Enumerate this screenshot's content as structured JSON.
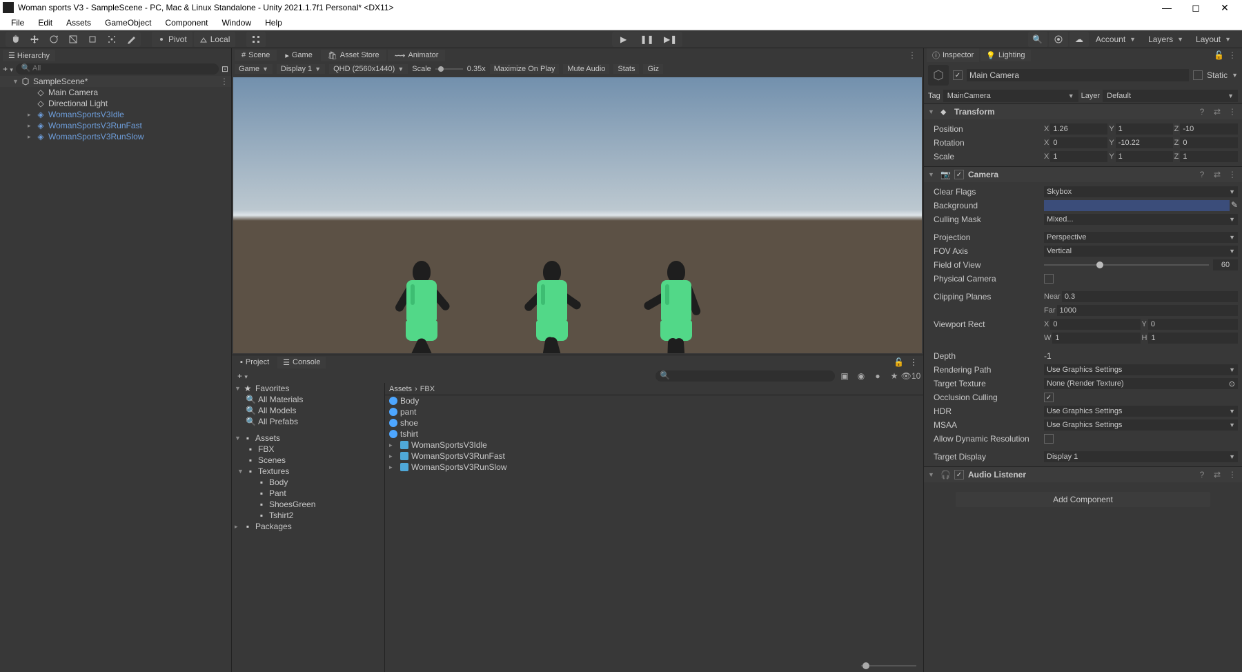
{
  "window": {
    "title": "Woman sports V3 - SampleScene - PC, Mac & Linux Standalone - Unity 2021.1.7f1 Personal* <DX11>"
  },
  "menu": [
    "File",
    "Edit",
    "Assets",
    "GameObject",
    "Component",
    "Window",
    "Help"
  ],
  "toolbar": {
    "pivot": "Pivot",
    "local": "Local",
    "account": "Account",
    "layers": "Layers",
    "layout": "Layout"
  },
  "hierarchy": {
    "tab": "Hierarchy",
    "search_placeholder": "All",
    "scene": "SampleScene*",
    "items": [
      {
        "label": "Main Camera",
        "prefab": false
      },
      {
        "label": "Directional Light",
        "prefab": false
      },
      {
        "label": "WomanSportsV3Idle",
        "prefab": true
      },
      {
        "label": "WomanSportsV3RunFast",
        "prefab": true
      },
      {
        "label": "WomanSportsV3RunSlow",
        "prefab": true
      }
    ]
  },
  "scene": {
    "tabs": [
      "Scene",
      "Game",
      "Asset Store",
      "Animator"
    ],
    "active_tab": 1,
    "game_aspect": "Game",
    "display": "Display 1",
    "resolution": "QHD (2560x1440)",
    "scale_label": "Scale",
    "scale_value": "0.35x",
    "maximize": "Maximize On Play",
    "mute": "Mute Audio",
    "stats": "Stats",
    "gizmos": "Giz"
  },
  "project": {
    "tabs": [
      "Project",
      "Console"
    ],
    "count_label": "10",
    "favorites": "Favorites",
    "fav_items": [
      "All Materials",
      "All Models",
      "All Prefabs"
    ],
    "assets": "Assets",
    "folders": [
      "FBX",
      "Scenes",
      "Textures"
    ],
    "tex_sub": [
      "Body",
      "Pant",
      "ShoesGreen",
      "Tshirt2"
    ],
    "packages": "Packages",
    "breadcrumb": [
      "Assets",
      "FBX"
    ],
    "files": [
      {
        "label": "Body",
        "type": "mat"
      },
      {
        "label": "pant",
        "type": "mat"
      },
      {
        "label": "shoe",
        "type": "mat"
      },
      {
        "label": "tshirt",
        "type": "mat"
      },
      {
        "label": "WomanSportsV3Idle",
        "type": "model"
      },
      {
        "label": "WomanSportsV3RunFast",
        "type": "model"
      },
      {
        "label": "WomanSportsV3RunSlow",
        "type": "model"
      }
    ]
  },
  "inspector": {
    "tab_inspector": "Inspector",
    "tab_lighting": "Lighting",
    "go_name": "Main Camera",
    "static": "Static",
    "tag_label": "Tag",
    "tag_value": "MainCamera",
    "layer_label": "Layer",
    "layer_value": "Default",
    "transform": {
      "title": "Transform",
      "position": "Position",
      "px": "1.26",
      "py": "1",
      "pz": "-10",
      "rotation": "Rotation",
      "rx": "0",
      "ry": "-10.22",
      "rz": "0",
      "scale": "Scale",
      "sx": "1",
      "sy": "1",
      "sz": "1"
    },
    "camera": {
      "title": "Camera",
      "clear_flags": "Clear Flags",
      "clear_flags_v": "Skybox",
      "background": "Background",
      "culling": "Culling Mask",
      "culling_v": "Mixed...",
      "projection": "Projection",
      "projection_v": "Perspective",
      "fov_axis": "FOV Axis",
      "fov_axis_v": "Vertical",
      "fov": "Field of View",
      "fov_v": "60",
      "physical": "Physical Camera",
      "clipping": "Clipping Planes",
      "near_l": "Near",
      "near_v": "0.3",
      "far_l": "Far",
      "far_v": "1000",
      "viewport": "Viewport Rect",
      "vx": "0",
      "vy": "0",
      "vw": "1",
      "vh": "1",
      "depth": "Depth",
      "depth_v": "-1",
      "rendering": "Rendering Path",
      "rendering_v": "Use Graphics Settings",
      "texture": "Target Texture",
      "texture_v": "None (Render Texture)",
      "occlusion": "Occlusion Culling",
      "hdr": "HDR",
      "hdr_v": "Use Graphics Settings",
      "msaa": "MSAA",
      "msaa_v": "Use Graphics Settings",
      "dynamic": "Allow Dynamic Resolution",
      "display": "Target Display",
      "display_v": "Display 1"
    },
    "audio": {
      "title": "Audio Listener"
    },
    "add_component": "Add Component"
  }
}
